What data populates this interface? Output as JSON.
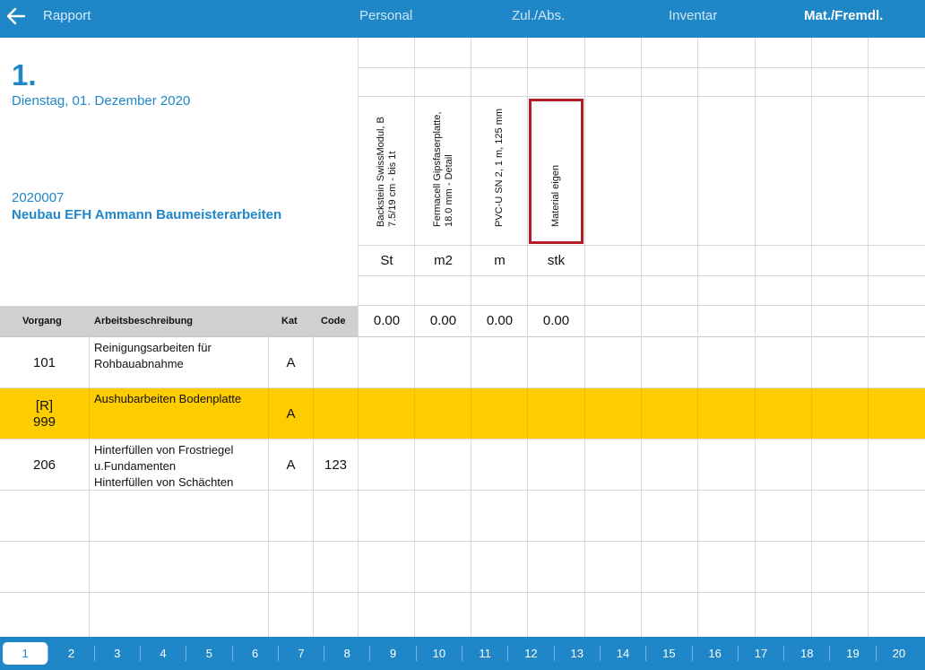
{
  "topbar": {
    "back_icon": "arrow-left-icon",
    "title": "Rapport",
    "tabs": [
      {
        "label": "Personal",
        "active": false
      },
      {
        "label": "Zul./Abs.",
        "active": false
      },
      {
        "label": "Inventar",
        "active": false
      },
      {
        "label": "Mat./Fremdl.",
        "active": true
      }
    ]
  },
  "header": {
    "day": "1.",
    "date": "Dienstag, 01. Dezember 2020",
    "project_number": "2020007",
    "project_name": "Neubau EFH Ammann Baumeisterarbeiten"
  },
  "materials": [
    {
      "name": "Backstein SwissModul, B 7.5/19 cm - bis 1t",
      "unit": "St",
      "total": "0.00"
    },
    {
      "name": "Fermacell Gipsfaserplatte, 18.0 mm - Detail",
      "unit": "m2",
      "total": "0.00"
    },
    {
      "name": "PVC-U SN 2, 1 m, 125 mm",
      "unit": "m",
      "total": "0.00"
    },
    {
      "name": "Material eigen",
      "unit": "stk",
      "total": "0.00"
    }
  ],
  "table": {
    "columns": {
      "vorgang": "Vorgang",
      "beschreibung": "Arbeitsbeschreibung",
      "kat": "Kat",
      "code": "Code"
    },
    "rows": [
      {
        "vorgang": "101",
        "beschreibung": "Reinigungsarbeiten für Rohbauabnahme",
        "kat": "A",
        "code": "",
        "highlight": false
      },
      {
        "vorgang": "[R]\n999",
        "beschreibung": "Aushubarbeiten Bodenplatte",
        "kat": "A",
        "code": "",
        "highlight": true
      },
      {
        "vorgang": "206",
        "beschreibung": "Hinterfüllen von Frostriegel u.Fundamenten\nHinterfüllen von Schächten",
        "kat": "A",
        "code": "123",
        "highlight": false
      }
    ]
  },
  "pager": {
    "pages": [
      "1",
      "2",
      "3",
      "4",
      "5",
      "6",
      "7",
      "8",
      "9",
      "10",
      "11",
      "12",
      "13",
      "14",
      "15",
      "16",
      "17",
      "18",
      "19",
      "20"
    ],
    "active": "1"
  },
  "colors": {
    "accent": "#1f87c8",
    "highlight_row": "#fecd00",
    "header_bg": "#d0d0d0",
    "selection_border": "#b31d23"
  }
}
